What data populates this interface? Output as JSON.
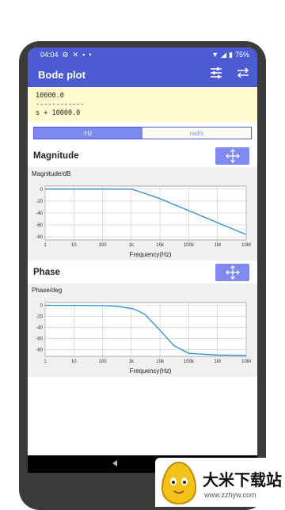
{
  "status": {
    "time": "04:04",
    "battery": "75%"
  },
  "app": {
    "title": "Bode plot"
  },
  "transfer_function": {
    "numerator": "10000.0",
    "divider": "------------",
    "denominator": "s + 10000.0"
  },
  "units": {
    "hz": "Hz",
    "rads": "rad/s",
    "selected": "Hz"
  },
  "magnitude": {
    "section_label": "Magnitude"
  },
  "phase": {
    "section_label": "Phase"
  },
  "watermark": {
    "text": "大米下载站",
    "url": "www.zzhyw.com"
  },
  "colors": {
    "accent": "#4c5bd4",
    "button": "#7f8af0",
    "curve": "#2a8ed8",
    "tf_bg": "#fffad0"
  },
  "chart_data": [
    {
      "type": "line",
      "ylabel": "Magnitude/dB",
      "xlabel": "Frequency(Hz)",
      "x_scale": "log",
      "xticks": [
        "1",
        "10",
        "100",
        "1k",
        "10k",
        "100k",
        "1M",
        "10M"
      ],
      "yticks": [
        "0",
        "-20",
        "-40",
        "-60",
        "-80"
      ],
      "xlim": [
        1,
        10000000
      ],
      "ylim": [
        -85,
        5
      ],
      "grid": true,
      "series": [
        {
          "x": [
            1,
            100,
            1000,
            1591,
            10000,
            100000,
            1000000,
            10000000
          ],
          "y": [
            0,
            0,
            -0.2,
            -3,
            -16,
            -36,
            -56,
            -76
          ]
        }
      ]
    },
    {
      "type": "line",
      "ylabel": "Phase/deg",
      "xlabel": "Frequency(Hz)",
      "x_scale": "log",
      "xticks": [
        "1",
        "10",
        "100",
        "1k",
        "10k",
        "100k",
        "1M",
        "10M"
      ],
      "yticks": [
        "0",
        "-20",
        "-40",
        "-60",
        "-80"
      ],
      "xlim": [
        1,
        10000000
      ],
      "ylim": [
        -92,
        5
      ],
      "grid": true,
      "series": [
        {
          "x": [
            1,
            10,
            100,
            300,
            1000,
            1591,
            3000,
            10000,
            30000,
            100000,
            1000000,
            10000000
          ],
          "y": [
            0,
            -0.1,
            -0.6,
            -1.7,
            -5.7,
            -9,
            -16.7,
            -45,
            -72.3,
            -86.6,
            -89.6,
            -90
          ]
        }
      ]
    }
  ]
}
